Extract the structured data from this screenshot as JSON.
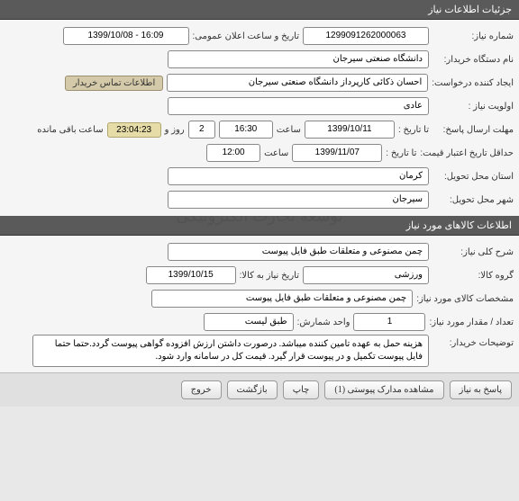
{
  "section1": {
    "title": "جزئیات اطلاعات نیاز",
    "need_no_label": "شماره نیاز:",
    "need_no": "1299091262000063",
    "public_announce_label": "تاریخ و ساعت اعلان عمومی:",
    "public_announce": "1399/10/08 - 16:09",
    "buyer_label": "نام دستگاه خریدار:",
    "buyer": "دانشگاه صنعتی سیرجان",
    "requester_label": "ایجاد کننده درخواست:",
    "requester": "احسان ذکائی کارپرداز دانشگاه صنعتی سیرجان",
    "contact_link": "اطلاعات تماس خریدار",
    "priority_label": "اولویت نیاز :",
    "priority": "عادی",
    "deadline_label": "مهلت ارسال پاسخ:",
    "to_date_label": "تا تاریخ :",
    "deadline_date": "1399/10/11",
    "time_label": "ساعت",
    "deadline_time": "16:30",
    "days": "2",
    "days_label": "روز و",
    "countdown": "23:04:23",
    "remain_label": "ساعت باقی مانده",
    "validity_label": "حداقل تاریخ اعتبار قیمت:",
    "validity_date": "1399/11/07",
    "validity_time": "12:00",
    "province_label": "استان محل تحویل:",
    "province": "کرمان",
    "city_label": "شهر محل تحویل:",
    "city": "سیرجان"
  },
  "section2": {
    "title": "اطلاعات کالاهای مورد نیاز",
    "desc_label": "شرح کلی نیاز:",
    "desc": "چمن مصنوعی و متعلقات طبق فایل پیوست",
    "group_label": "گروه کالا:",
    "group": "ورزشی",
    "need_date_label": "تاریخ نیاز به کالا:",
    "need_date": "1399/10/15",
    "spec_label": "مشخصات کالای مورد نیاز:",
    "spec": "چمن مصنوعی و متعلقات طبق فایل پیوست",
    "qty_label": "تعداد / مقدار مورد نیاز:",
    "qty": "1",
    "unit_label": "واحد شمارش:",
    "unit": "طبق لیست",
    "notes_label": "توضیحات خریدار:",
    "notes": "هزینه حمل به عهده تامین کننده میباشد. درصورت داشتن ارزش افزوده گواهی پیوست گردد.حتما حتما فایل پیوست تکمیل و در پیوست قرار گیرد. قیمت کل در سامانه وارد شود."
  },
  "buttons": {
    "reply": "پاسخ به نیاز",
    "attachments": "مشاهده مدارک پیوستی  (1)",
    "print": "چاپ",
    "back": "بازگشت",
    "exit": "خروج"
  },
  "watermark": "سامانه تدارکات الکترونیکی دولت\nمرکز توسعه تجارت الکترونیکی"
}
